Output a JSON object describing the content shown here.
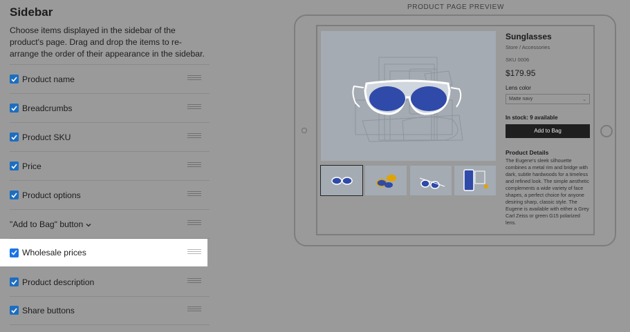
{
  "sidebar_settings": {
    "title": "Sidebar",
    "description": "Choose items displayed in the sidebar of the product's page. Drag and drop the items to re-arrange the order of their appearance in the sidebar.",
    "items": [
      {
        "label": "Product name",
        "checked": true
      },
      {
        "label": "Breadcrumbs",
        "checked": true
      },
      {
        "label": "Product SKU",
        "checked": true
      },
      {
        "label": "Price",
        "checked": true
      },
      {
        "label": "Product options",
        "checked": true
      },
      {
        "label": "\"Add to Bag\" button",
        "checked": null,
        "has_dropdown": true
      },
      {
        "label": "Wholesale prices",
        "checked": true,
        "highlighted": true
      },
      {
        "label": "Product description",
        "checked": true
      },
      {
        "label": "Share buttons",
        "checked": true
      }
    ]
  },
  "preview": {
    "label": "PRODUCT PAGE PREVIEW",
    "product": {
      "name": "Sunglasses",
      "breadcrumbs": "Store  /  Accessories",
      "sku": "SKU 0006",
      "price": "$179.95",
      "option_label": "Lens color",
      "option_value": "Matte navy",
      "stock": "In stock: 9 available",
      "add_to_bag": "Add to Bag",
      "details_title": "Product Details",
      "details_text": "The Eugene's sleek silhouette combines a metal rim and bridge with dark, subtle hardwoods for a timeless and refined look. The simple aesthetic complements a wide variety of face shapes, a perfect choice for anyone desiring sharp, classic style. The Eugene is available with either a Grey Carl Zeiss or green G15 polarized lens."
    }
  },
  "colors": {
    "checkbox": "#1d6ec0",
    "lens": "#2f4aa8",
    "overlay_bg": "#9a9a9a"
  }
}
